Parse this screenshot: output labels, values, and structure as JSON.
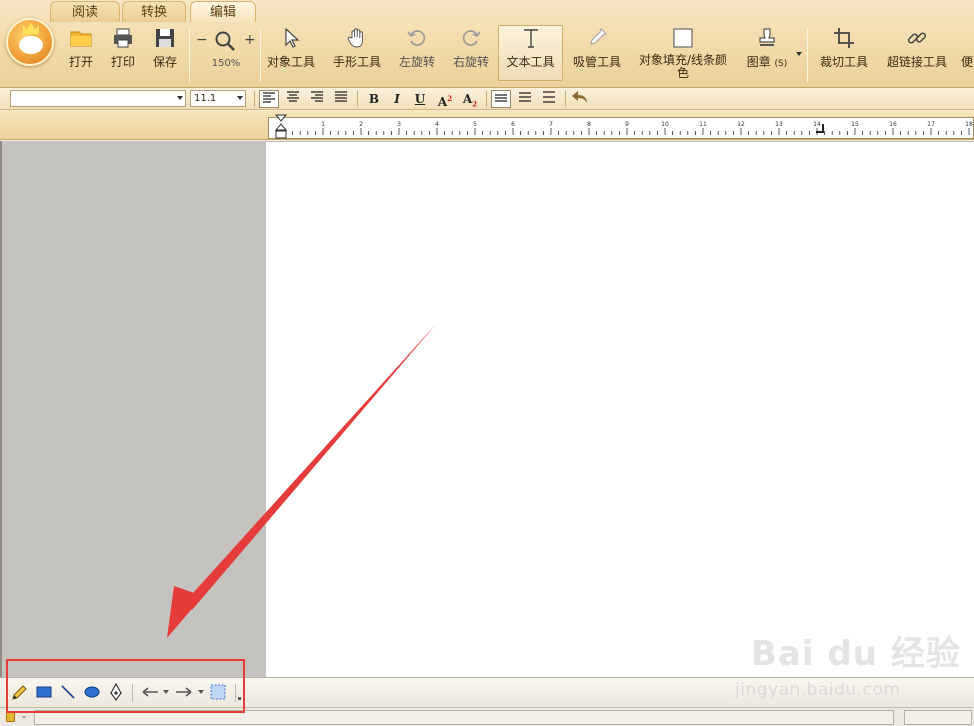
{
  "tabs": [
    {
      "label": "阅读",
      "active": false
    },
    {
      "label": "转换",
      "active": false
    },
    {
      "label": "编辑",
      "active": true
    }
  ],
  "toolbar": {
    "open": "打开",
    "print": "打印",
    "save": "保存",
    "zoom_out": "−",
    "zoom_in": "+",
    "zoom_level": "150%",
    "object_tool": "对象工具",
    "hand_tool": "手形工具",
    "rotate_left": "左旋转",
    "rotate_right": "右旋转",
    "text_tool": "文本工具",
    "eyedropper": "吸管工具",
    "fill_line_color_1": "对象填充/线条颜",
    "fill_line_color_2": "色",
    "stamp": "图章",
    "stamp_shortcut": "(S)",
    "crop_tool": "裁切工具",
    "hyperlink_tool": "超链接工具",
    "overflow": "便"
  },
  "format_bar": {
    "font_name": "",
    "font_size": "11.1",
    "bold": "B",
    "italic": "I",
    "underline": "U",
    "superscript": "A",
    "superscript_mark": "2",
    "subscript": "A",
    "subscript_mark": "2"
  },
  "ruler": {
    "numbers": [
      "1",
      "2",
      "3",
      "4",
      "5",
      "6",
      "7",
      "8",
      "9",
      "10",
      "11",
      "12",
      "13",
      "14",
      "15",
      "16",
      "17",
      "18"
    ]
  },
  "status": {
    "text": "-"
  },
  "watermark": {
    "brand": "Bai du 经验",
    "url": "jingyan.baidu.com"
  },
  "colors": {
    "accent_red": "#e53b3b",
    "ribbon": "#f3dcad"
  }
}
